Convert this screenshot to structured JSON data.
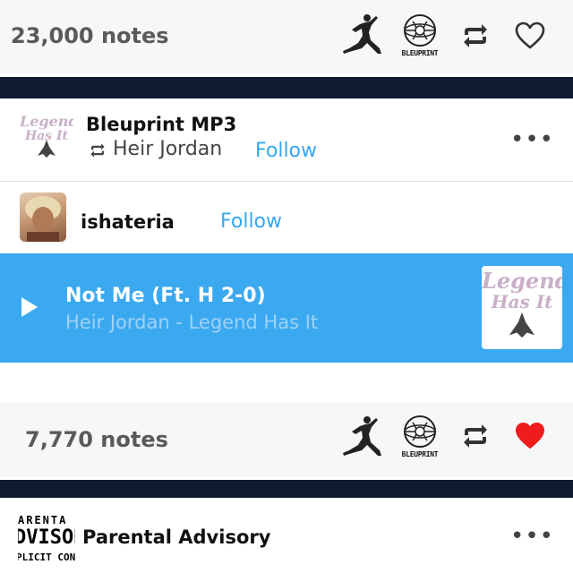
{
  "post_top": {
    "notes_label": "23,000 notes",
    "liked": false
  },
  "reblog_header": {
    "blog_name": "Bleuprint MP3",
    "reblogged_from": "Heir Jordan",
    "follow_label": "Follow",
    "avatar_text": [
      "Legend",
      "Has It"
    ]
  },
  "reblogger": {
    "name": "ishateria",
    "follow_label": "Follow"
  },
  "track": {
    "title": "Not Me (Ft. H 2-0)",
    "subtitle": "Heir Jordan - Legend Has It",
    "art_text": [
      "Legend",
      "Has It"
    ]
  },
  "post_bottom": {
    "notes_label": "7,770 notes",
    "liked": true
  },
  "next_post": {
    "blog_name": "Parental Advisory",
    "logo_rows": [
      "ARENTA",
      "DVISOR",
      "PLICIT CONTE"
    ]
  },
  "icons": {
    "jumpman": "jumpman-icon",
    "bleuprint": "bleuprint-badge-icon",
    "bleuprint_word": "BLEUPRINT",
    "reblog": "reblog-icon",
    "heart": "heart-icon",
    "more": "more-icon",
    "play": "play-icon"
  },
  "colors": {
    "accent_blue": "#3ba9f0",
    "follow_blue": "#35a8f0",
    "navy": "#0f1a30",
    "liked_red": "#ee1c1c"
  },
  "more_glyph": "•••"
}
